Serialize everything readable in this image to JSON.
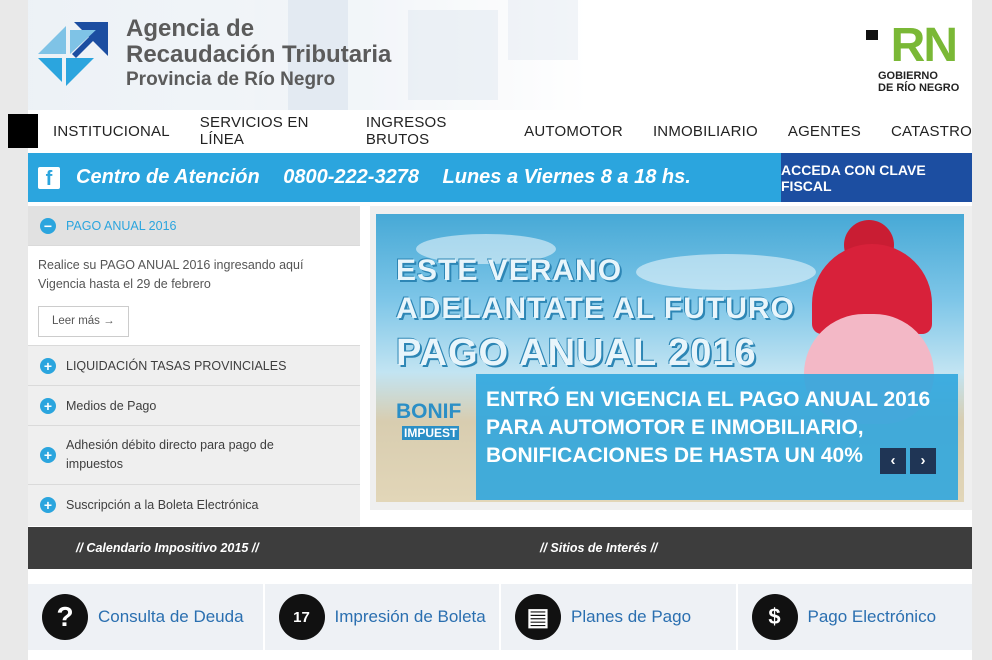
{
  "header": {
    "agency_line1": "Agencia de",
    "agency_line2": "Recaudación Tributaria",
    "agency_line3": "Provincia de Río Negro",
    "rn_letters": "RN",
    "rn_gov_line1": "GOBIERNO",
    "rn_gov_line2": "DE RÍO NEGRO"
  },
  "nav": {
    "items": [
      "INSTITUCIONAL",
      "SERVICIOS EN LÍNEA",
      "INGRESOS BRUTOS",
      "AUTOMOTOR",
      "INMOBILIARIO",
      "AGENTES",
      "CATASTRO"
    ]
  },
  "attention": {
    "facebook": "f",
    "label": "Centro de Atención",
    "phone": "0800-222-3278",
    "hours": "Lunes a Viernes 8 a 18 hs.",
    "login": "ACCEDA CON CLAVE FISCAL"
  },
  "accordion": {
    "open_title": "PAGO ANUAL 2016",
    "open_line1": "Realice su PAGO ANUAL 2016 ingresando aquí",
    "open_line2": "Vigencia hasta el 29 de febrero",
    "more": "Leer más →",
    "items": [
      "LIQUIDACIÓN TASAS PROVINCIALES",
      "Medios de Pago",
      "Adhesión débito directo para pago de impuestos",
      "Suscripción a la Boleta Electrónica"
    ]
  },
  "slider": {
    "title1": "ESTE VERANO",
    "title2": "ADELANTATE AL FUTURO",
    "title3": "PAGO ANUAL 2016",
    "bonif": "BONIF",
    "impues": "IMPUEST",
    "caption1": "ENTRÓ EN VIGENCIA EL PAGO ANUAL 2016",
    "caption2": "PARA AUTOMOTOR E INMOBILIARIO,",
    "caption3": "BONIFICACIONES DE HASTA UN 40%",
    "prev": "‹",
    "next": "›"
  },
  "darkbar": {
    "calendar": "// Calendario Impositivo 2015 //",
    "sites": "// Sitios de Interés //"
  },
  "quick": [
    {
      "label": "Consulta de Deuda",
      "icon": "?"
    },
    {
      "label": "Impresión de Boleta",
      "icon": "17"
    },
    {
      "label": "Planes de Pago",
      "icon": "▤"
    },
    {
      "label": "Pago Electrónico",
      "icon": "$"
    }
  ]
}
